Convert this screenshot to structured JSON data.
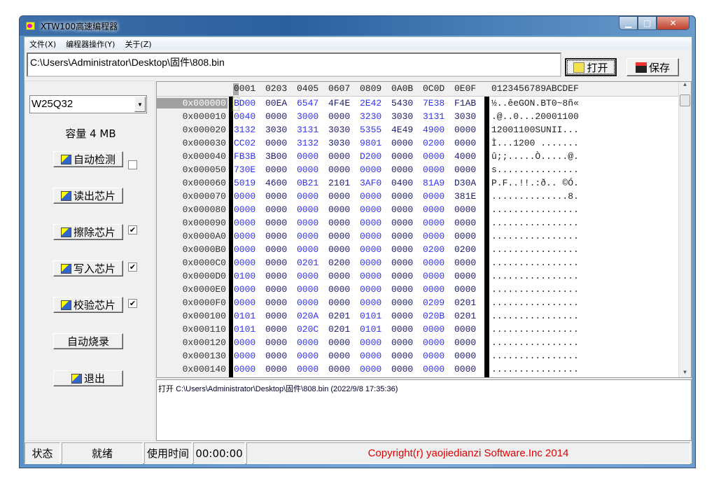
{
  "window": {
    "title": "XTW100高速编程器"
  },
  "menu": [
    "文件(X)",
    "编程器操作(Y)",
    "关于(Z)"
  ],
  "path": {
    "value": "C:\\Users\\Administrator\\Desktop\\固件\\808.bin"
  },
  "toolbar": {
    "open_label": "打开",
    "save_label": "保存"
  },
  "left": {
    "chip_model": "W25Q32",
    "capacity": "容量 4 MB",
    "buttons": [
      {
        "label": "自动检测",
        "icon": "auto-detect-icon",
        "checkbox": false
      },
      {
        "label": "读出芯片",
        "icon": "read-chip-icon"
      },
      {
        "label": "擦除芯片",
        "icon": "erase-chip-icon",
        "checkbox": true
      },
      {
        "label": "写入芯片",
        "icon": "write-chip-icon",
        "checkbox": true
      },
      {
        "label": "校验芯片",
        "icon": "verify-chip-icon",
        "checkbox": true
      },
      {
        "label": "自动烧录"
      },
      {
        "label": "退出",
        "icon": "exit-icon"
      }
    ]
  },
  "hex": {
    "header_cols": [
      "0001",
      "0203",
      "0405",
      "0607",
      "0809",
      "0A0B",
      "0C0D",
      "0E0F"
    ],
    "ascii_header": "0123456789ABCDEF",
    "colors": {
      "blue": "#3030ff",
      "navy": "#202068"
    },
    "rows": [
      {
        "addr": "0x000000",
        "bytes": [
          "BD00",
          "00EA",
          "6547",
          "4F4E",
          "2E42",
          "5430",
          "7E38",
          "F1AB"
        ],
        "ascii": "½..êeGON.BT0~8ñ«"
      },
      {
        "addr": "0x000010",
        "bytes": [
          "0040",
          "0000",
          "3000",
          "0000",
          "3230",
          "3030",
          "3131",
          "3030"
        ],
        "ascii": ".@..0...20001100"
      },
      {
        "addr": "0x000020",
        "bytes": [
          "3132",
          "3030",
          "3131",
          "3030",
          "5355",
          "4E49",
          "4900",
          "0000"
        ],
        "ascii": "12001100SUNII..."
      },
      {
        "addr": "0x000030",
        "bytes": [
          "CC02",
          "0000",
          "3132",
          "3030",
          "9801",
          "0000",
          "0200",
          "0000"
        ],
        "ascii": "Ì...1200 ......."
      },
      {
        "addr": "0x000040",
        "bytes": [
          "FB3B",
          "3B00",
          "0000",
          "0000",
          "D200",
          "0000",
          "0000",
          "4000"
        ],
        "ascii": "û;;.....Ò.....@."
      },
      {
        "addr": "0x000050",
        "bytes": [
          "730E",
          "0000",
          "0000",
          "0000",
          "0000",
          "0000",
          "0000",
          "0000"
        ],
        "ascii": "s..............."
      },
      {
        "addr": "0x000060",
        "bytes": [
          "5019",
          "4600",
          "0B21",
          "2101",
          "3AF0",
          "0400",
          "81A9",
          "D30A"
        ],
        "ascii": "P.F..!!.:ð.. ©Ó."
      },
      {
        "addr": "0x000070",
        "bytes": [
          "0000",
          "0000",
          "0000",
          "0000",
          "0000",
          "0000",
          "0000",
          "381E"
        ],
        "ascii": "..............8."
      },
      {
        "addr": "0x000080",
        "bytes": [
          "0000",
          "0000",
          "0000",
          "0000",
          "0000",
          "0000",
          "0000",
          "0000"
        ],
        "ascii": "................"
      },
      {
        "addr": "0x000090",
        "bytes": [
          "0000",
          "0000",
          "0000",
          "0000",
          "0000",
          "0000",
          "0000",
          "0000"
        ],
        "ascii": "................"
      },
      {
        "addr": "0x0000A0",
        "bytes": [
          "0000",
          "0000",
          "0000",
          "0000",
          "0000",
          "0000",
          "0000",
          "0000"
        ],
        "ascii": "................"
      },
      {
        "addr": "0x0000B0",
        "bytes": [
          "0000",
          "0000",
          "0000",
          "0000",
          "0000",
          "0000",
          "0200",
          "0200"
        ],
        "ascii": "................"
      },
      {
        "addr": "0x0000C0",
        "bytes": [
          "0000",
          "0000",
          "0201",
          "0200",
          "0000",
          "0000",
          "0000",
          "0000"
        ],
        "ascii": "................"
      },
      {
        "addr": "0x0000D0",
        "bytes": [
          "0100",
          "0000",
          "0000",
          "0000",
          "0000",
          "0000",
          "0000",
          "0000"
        ],
        "ascii": "................"
      },
      {
        "addr": "0x0000E0",
        "bytes": [
          "0000",
          "0000",
          "0000",
          "0000",
          "0000",
          "0000",
          "0000",
          "0000"
        ],
        "ascii": "................"
      },
      {
        "addr": "0x0000F0",
        "bytes": [
          "0000",
          "0000",
          "0000",
          "0000",
          "0000",
          "0000",
          "0209",
          "0201"
        ],
        "ascii": "................"
      },
      {
        "addr": "0x000100",
        "bytes": [
          "0101",
          "0000",
          "020A",
          "0201",
          "0101",
          "0000",
          "020B",
          "0201"
        ],
        "ascii": "................"
      },
      {
        "addr": "0x000110",
        "bytes": [
          "0101",
          "0000",
          "020C",
          "0201",
          "0101",
          "0000",
          "0000",
          "0000"
        ],
        "ascii": "................"
      },
      {
        "addr": "0x000120",
        "bytes": [
          "0000",
          "0000",
          "0000",
          "0000",
          "0000",
          "0000",
          "0000",
          "0000"
        ],
        "ascii": "................"
      },
      {
        "addr": "0x000130",
        "bytes": [
          "0000",
          "0000",
          "0000",
          "0000",
          "0000",
          "0000",
          "0000",
          "0000"
        ],
        "ascii": "................"
      },
      {
        "addr": "0x000140",
        "bytes": [
          "0000",
          "0000",
          "0000",
          "0000",
          "0000",
          "0000",
          "0000",
          "0000"
        ],
        "ascii": "................"
      }
    ]
  },
  "log": {
    "action": "打开",
    "message": "C:\\Users\\Administrator\\Desktop\\固件\\808.bin (2022/9/8 17:35:36)"
  },
  "status": {
    "state_label": "状态",
    "state_value": "就绪",
    "time_label": "使用时间",
    "time_value": "00:00:00",
    "copyright": "Copyright(r) yaojiedianzi Software.Inc 2014"
  }
}
